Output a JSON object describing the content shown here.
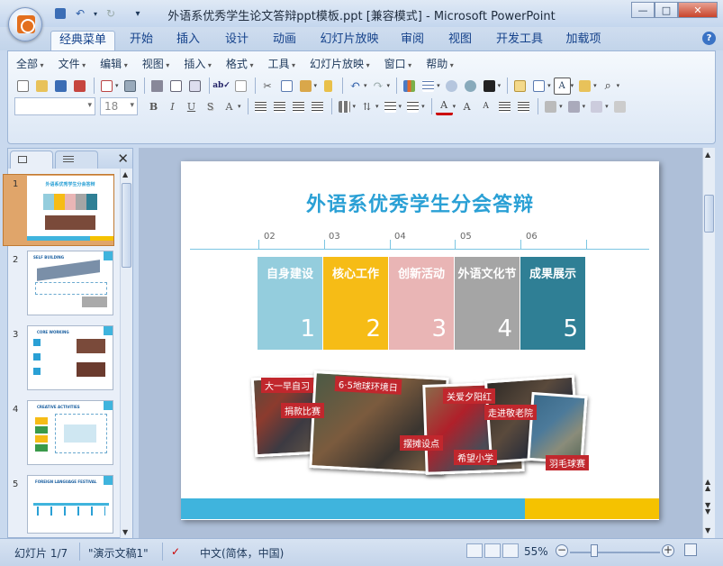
{
  "window": {
    "title": "外语系优秀学生论文答辩ppt模板.ppt [兼容模式] - Microsoft PowerPoint",
    "minimize": "—",
    "maximize": "□",
    "close": "✕"
  },
  "ribbon_tabs": [
    "经典菜单",
    "开始",
    "插入",
    "设计",
    "动画",
    "幻灯片放映",
    "审阅",
    "视图",
    "开发工具",
    "加载项"
  ],
  "classic_menu": [
    "全部",
    "文件",
    "编辑",
    "视图",
    "插入",
    "格式",
    "工具",
    "幻灯片放映",
    "窗口",
    "帮助"
  ],
  "font": {
    "name": "",
    "size": "18"
  },
  "format_buttons": {
    "bold": "B",
    "italic": "I",
    "underline": "U",
    "shadow": "S",
    "spacing": "A"
  },
  "slide_thumbnails": [
    {
      "number": "1",
      "title": "外语系优秀学生分会答辩"
    },
    {
      "number": "2",
      "title": "SELF BUILDING"
    },
    {
      "number": "3",
      "title": "CORE WORKING"
    },
    {
      "number": "4",
      "title": "CREATIVE ACTIVITIES"
    },
    {
      "number": "5",
      "title": "FOREIGN LANGUAGE FESTIVAL"
    }
  ],
  "slide": {
    "title": "外语系优秀学生分会答辩",
    "timeline_numbers": [
      "02",
      "03",
      "04",
      "05",
      "06"
    ],
    "boxes": [
      {
        "label": "自身建设",
        "number": "1",
        "color": "#94cddd"
      },
      {
        "label": "核心工作",
        "number": "2",
        "color": "#f6bc16"
      },
      {
        "label": "创新活动",
        "number": "3",
        "color": "#e9b5b5"
      },
      {
        "label": "外语文化节",
        "number": "4",
        "color": "#a5a5a5"
      },
      {
        "label": "成果展示",
        "number": "5",
        "color": "#2f7f95"
      }
    ],
    "photo_tags": [
      "大一早自习",
      "捐款比赛",
      "6·5地球环境日",
      "摆摊设点",
      "关爱夕阳红",
      "走进敬老院",
      "希望小学",
      "羽毛球赛"
    ],
    "colors": {
      "title": "#2aa0d5",
      "bar_blue": "#3fb4dd",
      "bar_yellow": "#f5c200"
    }
  },
  "status": {
    "slide_indicator": "幻灯片 1/7",
    "theme": "\"演示文稿1\"",
    "language": "中文(简体，中国)",
    "zoom": "55%",
    "zoom_minus": "−",
    "zoom_plus": "+"
  }
}
